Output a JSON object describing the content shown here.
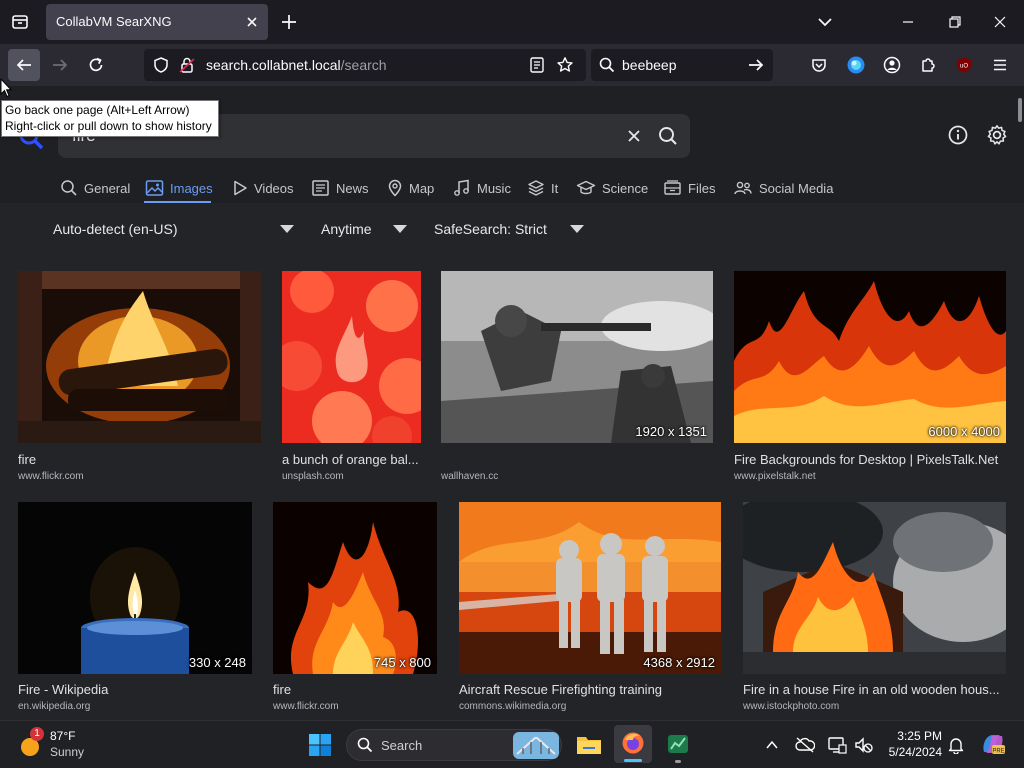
{
  "browser": {
    "tab_title": "CollabVM SearXNG",
    "url_host": "search.collabnet.local",
    "url_path": "/search",
    "search_bar_value": "beebeep",
    "tooltip_line1": "Go back one page (Alt+Left Arrow)",
    "tooltip_line2": "Right-click or pull down to show history"
  },
  "search": {
    "query": "fire",
    "categories": [
      "General",
      "Images",
      "Videos",
      "News",
      "Map",
      "Music",
      "It",
      "Science",
      "Files",
      "Social Media"
    ],
    "active_category": "Images",
    "filters": {
      "language": "Auto-detect (en-US)",
      "time": "Anytime",
      "safesearch": "SafeSearch: Strict"
    }
  },
  "results": [
    {
      "title": "fire",
      "source": "www.flickr.com",
      "dimensions": ""
    },
    {
      "title": "a bunch of orange bal...",
      "source": "unsplash.com",
      "dimensions": ""
    },
    {
      "title": "",
      "source": "wallhaven.cc",
      "dimensions": "1920 x 1351"
    },
    {
      "title": "Fire Backgrounds for Desktop | PixelsTalk.Net",
      "source": "www.pixelstalk.net",
      "dimensions": "6000 x 4000"
    },
    {
      "title": "Fire - Wikipedia",
      "source": "en.wikipedia.org",
      "dimensions": "330 x 248"
    },
    {
      "title": "fire",
      "source": "www.flickr.com",
      "dimensions": "745 x 800"
    },
    {
      "title": "Aircraft Rescue Firefighting training",
      "source": "commons.wikimedia.org",
      "dimensions": "4368 x 2912"
    },
    {
      "title": "Fire in a house Fire in an old wooden hous...",
      "source": "www.istockphoto.com",
      "dimensions": ""
    }
  ],
  "taskbar": {
    "weather_temp": "87°F",
    "weather_desc": "Sunny",
    "weather_badge": "1",
    "search_placeholder": "Search",
    "time": "3:25 PM",
    "date": "5/24/2024"
  },
  "colors": {
    "accent": "#6b9cf4",
    "browser_bg": "#1c1b22",
    "page_bg": "#222428"
  }
}
